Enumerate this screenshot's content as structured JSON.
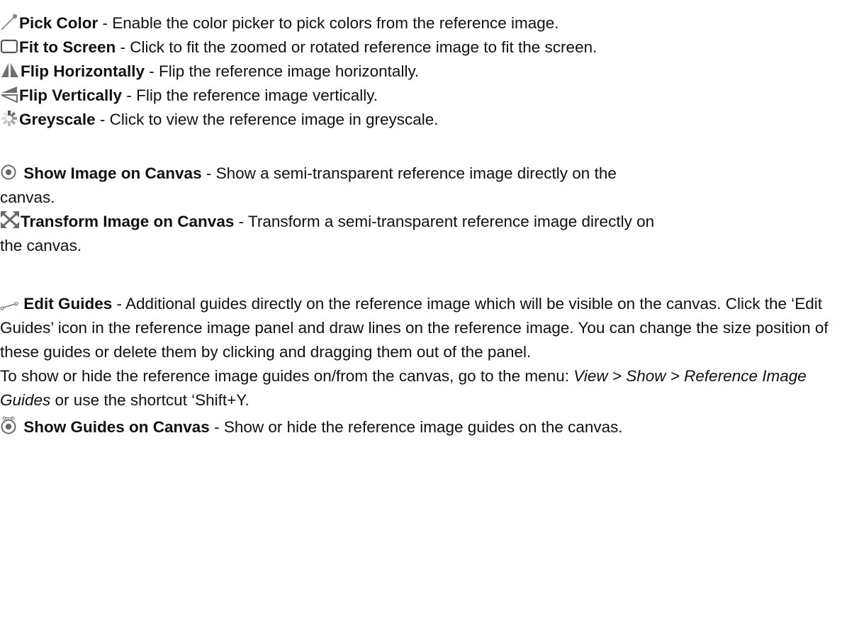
{
  "items": {
    "pick_color": {
      "icon": "eyedropper-icon",
      "title": "Pick Color",
      "desc": " - Enable the color picker to pick colors from the reference image."
    },
    "fit_to_screen": {
      "icon": "fit-screen-icon",
      "title": "Fit to Screen",
      "desc": " - Click to fit the zoomed or rotated reference image to fit the screen."
    },
    "flip_horizontally": {
      "icon": "flip-horizontal-icon",
      "title": "Flip Horizontally",
      "desc": " - Flip the reference image horizontally."
    },
    "flip_vertically": {
      "icon": "flip-vertical-icon",
      "title": "Flip Vertically",
      "desc": " - Flip the reference image vertically."
    },
    "greyscale": {
      "icon": "greyscale-icon",
      "title": "Greyscale",
      "desc": " - Click to view the reference image in greyscale."
    },
    "show_image_on_canvas": {
      "icon": "eye-icon",
      "title": "Show Image on Canvas",
      "desc_1": " - Show a semi-transparent reference image directly on the",
      "desc_2": "canvas."
    },
    "transform_image_on_canvas": {
      "icon": "transform-arrows-icon",
      "title": "Transform Image on Canvas",
      "desc_1": " - Transform a semi-transparent reference image directly on",
      "desc_2": "the canvas."
    },
    "edit_guides": {
      "icon": "guide-line-icon",
      "title": "Edit Guides",
      "desc": " - Additional guides directly on the reference image which will be visible on the canvas. Click the ‘Edit Guides’ icon in the reference image panel and draw lines on the reference image. You can change the size position of these guides or delete them by clicking and dragging them out of the panel."
    },
    "guides_note": {
      "prefix": "To show or hide the reference image guides on/from the canvas, go to the menu: ",
      "menu_path": "View > Show > Reference Image Guides",
      "suffix": " or use the shortcut ‘Shift+Y."
    },
    "show_guides_on_canvas": {
      "icon": "eye-guides-icon",
      "title": "Show Guides on Canvas",
      "desc": " - Show or hide the reference image guides on the canvas."
    }
  },
  "colors": {
    "text": "#111111",
    "icon_grey": "#8a8a8a",
    "icon_dark": "#6a6a6a"
  }
}
